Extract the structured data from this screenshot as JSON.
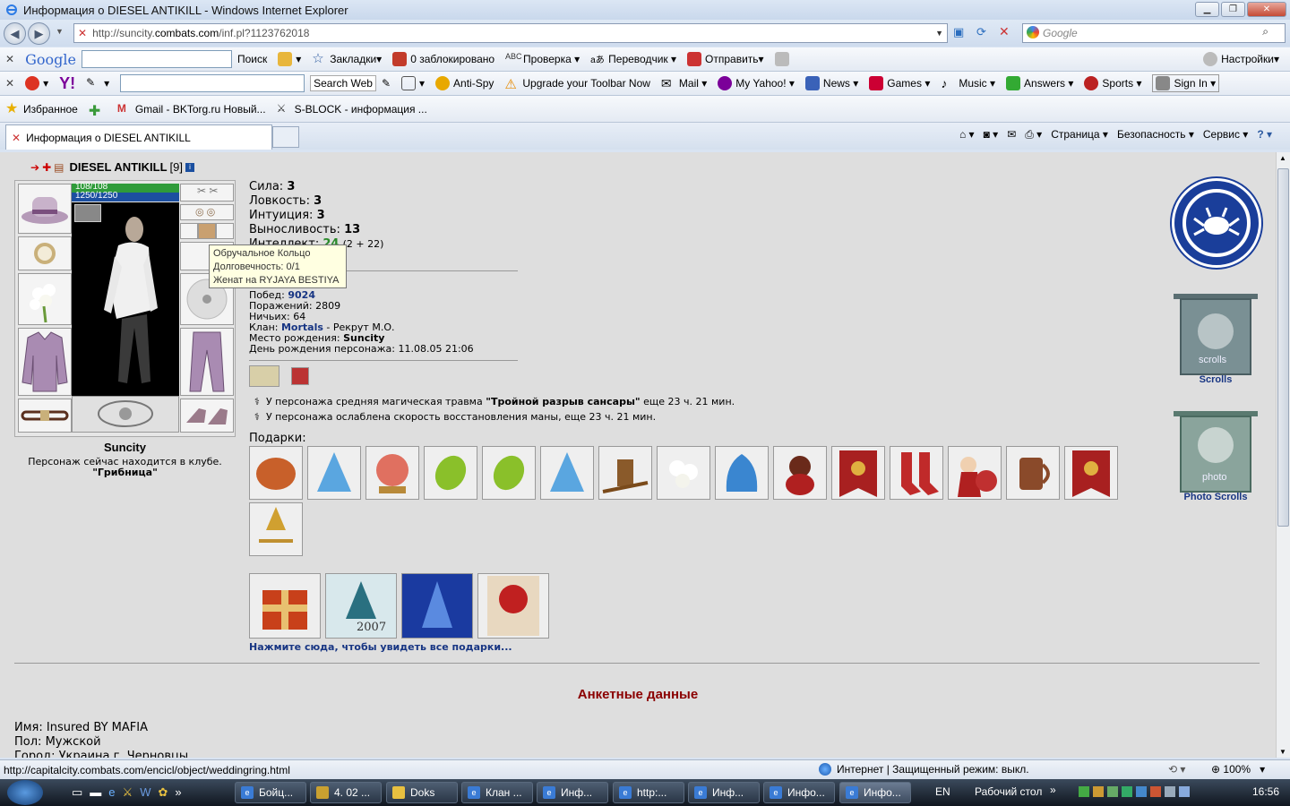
{
  "window": {
    "title": "Информация о DIESEL ANTIKILL - Windows Internet Explorer"
  },
  "address": {
    "url_prefix": "http://suncity.",
    "url_domain": "combats.com",
    "url_path": "/inf.pl?1123762018",
    "search_placeholder": "Google"
  },
  "google_toolbar": {
    "logo": "Google",
    "search_label": "Поиск",
    "bookmarks": "Закладки",
    "blocked": "0 заблокировано",
    "spellcheck": "Проверка",
    "translate": "Переводчик",
    "send": "Отправить",
    "settings": "Настройки"
  },
  "yahoo_toolbar": {
    "search_btn": "Search Web",
    "antispy": "Anti-Spy",
    "upgrade": "Upgrade your Toolbar Now",
    "mail": "Mail",
    "myyahoo": "My Yahoo!",
    "news": "News",
    "games": "Games",
    "music": "Music",
    "answers": "Answers",
    "sports": "Sports",
    "signin": "Sign In"
  },
  "favorites": {
    "label": "Избранное",
    "items": [
      "Gmail - BKTorg.ru Новый...",
      "S-BLOCK - информация ..."
    ]
  },
  "tabs": {
    "active": "Информация о DIESEL ANTIKILL",
    "cmd_page": "Страница",
    "cmd_security": "Безопасность",
    "cmd_service": "Сервис"
  },
  "character": {
    "name": "DIESEL ANTIKILL",
    "level": "[9]",
    "hp": "108/108",
    "mana": "1250/1250",
    "hp_fraction": 1.0,
    "mana_fraction": 1.0,
    "city": "Suncity",
    "location_text": "Персонаж сейчас находится в клубе.",
    "location_name": "\"Грибница\""
  },
  "stats": {
    "sila_label": "Сила:",
    "sila": "3",
    "lovk_label": "Ловкость:",
    "lovk": "3",
    "intu_label": "Интуиция:",
    "intu": "3",
    "vyn_label": "Выносливость:",
    "vyn": "13",
    "int_label": "Интеллект:",
    "int": "24",
    "int_extra": "(2 + 22)"
  },
  "tooltip": {
    "line1": "Обручальное Кольцо",
    "line2": "Долговечность: 0/1",
    "line3": "Женат на RYJAYA BESTIYA"
  },
  "record": {
    "wins_label": "Побед:",
    "wins": "9024",
    "losses_label": "Поражений:",
    "losses": "2809",
    "draws_label": "Ничьих:",
    "draws": "64",
    "clan_label": "Клан:",
    "clan": "Mortals",
    "clan_rank": "- Рекрут М.О.",
    "birthplace_label": "Место рождения:",
    "birthplace": "Suncity",
    "birthday_label": "День рождения персонажа:",
    "birthday": "11.08.05 21:06"
  },
  "effects": {
    "e1_pre": "У персонажа средняя магическая травма",
    "e1_name": "\"Тройной разрыв сансары\"",
    "e1_post": "еще 23 ч. 21 мин.",
    "e2": "У персонажа ослаблена скорость восстановления маны, еще 23 ч. 21 мин."
  },
  "gifts": {
    "label": "Подарки:",
    "see_all": "Нажмите сюда, чтобы увидеть все подарки...",
    "card_text_2007": "2007"
  },
  "sidebar": {
    "scrolls": "Scrolls",
    "photo_scrolls": "Photo Scrolls",
    "scrolls_img": "scrolls",
    "photo_img": "photo"
  },
  "anketa": {
    "title": "Анкетные данные",
    "name_label": "Имя:",
    "name": "Insured BY MAFIA",
    "sex_label": "Пол:",
    "sex": "Мужской",
    "city_partial": "Город: Украина г. Черновцы"
  },
  "statusbar": {
    "url": "http://capitalcity.combats.com/encicl/object/weddingring.html",
    "zone": "Интернет | Защищенный режим: выкл.",
    "zoom": "100%"
  },
  "taskbar": {
    "buttons": [
      "Бойц...",
      "4. 02 ...",
      "Doks",
      "Клан ...",
      "Инф...",
      "http:...",
      "Инф...",
      "Инфо...",
      "Инфо..."
    ],
    "lang": "EN",
    "desktop": "Рабочий стол",
    "time": "16:56"
  },
  "colors": {
    "hp": "#2f9b3a",
    "mana": "#1c4fa0",
    "header_red": "#8b0000",
    "link_blue": "#173583"
  }
}
